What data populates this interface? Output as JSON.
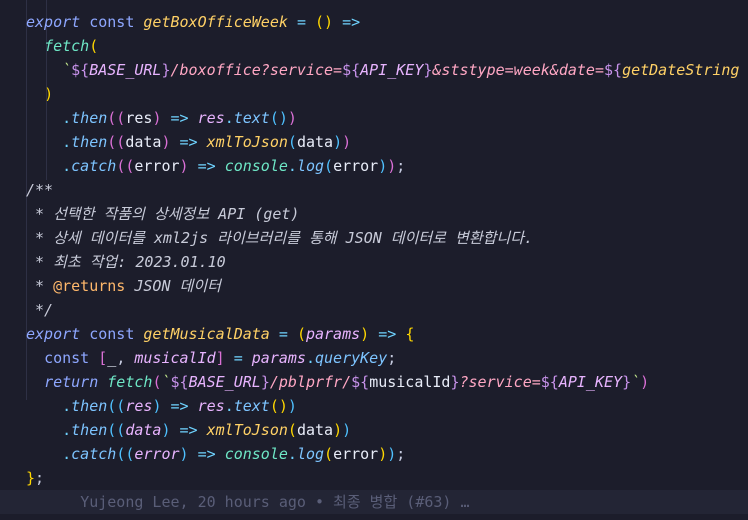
{
  "lines": [
    [
      [
        "kw",
        "export"
      ],
      [
        "var",
        " "
      ],
      [
        "kwn",
        "const"
      ],
      [
        "var",
        " "
      ],
      [
        "fn",
        "getBoxOfficeWeek"
      ],
      [
        "var",
        " "
      ],
      [
        "op",
        "="
      ],
      [
        "var",
        " "
      ],
      [
        "br1",
        "()"
      ],
      [
        "var",
        " "
      ],
      [
        "op",
        "=>"
      ]
    ],
    [
      [
        "var",
        "  "
      ],
      [
        "fnc",
        "fetch"
      ],
      [
        "br1",
        "("
      ]
    ],
    [
      [
        "var",
        "    "
      ],
      [
        "str",
        "`"
      ],
      [
        "tpl",
        "${"
      ],
      [
        "vari",
        "BASE_URL"
      ],
      [
        "tpl",
        "}"
      ],
      [
        "strp",
        "/boxoffice?service="
      ],
      [
        "tpl",
        "${"
      ],
      [
        "vari",
        "API_KEY"
      ],
      [
        "tpl",
        "}"
      ],
      [
        "strp",
        "&ststype=week&date="
      ],
      [
        "tpl",
        "${"
      ],
      [
        "fn",
        "getDateString"
      ]
    ],
    [
      [
        "var",
        "  "
      ],
      [
        "br1",
        ")"
      ]
    ],
    [
      [
        "var",
        "    "
      ],
      [
        "op",
        "."
      ],
      [
        "fnit",
        "then"
      ],
      [
        "br2",
        "(("
      ],
      [
        "var",
        "res"
      ],
      [
        "br2",
        ")"
      ],
      [
        "var",
        " "
      ],
      [
        "op",
        "=>"
      ],
      [
        "var",
        " "
      ],
      [
        "vari",
        "res"
      ],
      [
        "op",
        "."
      ],
      [
        "fnit",
        "text"
      ],
      [
        "br3",
        "()"
      ],
      [
        "br2",
        ")"
      ]
    ],
    [
      [
        "var",
        "    "
      ],
      [
        "op",
        "."
      ],
      [
        "fnit",
        "then"
      ],
      [
        "br2",
        "(("
      ],
      [
        "var",
        "data"
      ],
      [
        "br2",
        ")"
      ],
      [
        "var",
        " "
      ],
      [
        "op",
        "=>"
      ],
      [
        "var",
        " "
      ],
      [
        "fn",
        "xmlToJson"
      ],
      [
        "br3",
        "("
      ],
      [
        "var",
        "data"
      ],
      [
        "br3",
        ")"
      ],
      [
        "br2",
        ")"
      ]
    ],
    [
      [
        "var",
        "    "
      ],
      [
        "op",
        "."
      ],
      [
        "fnit",
        "catch"
      ],
      [
        "br2",
        "(("
      ],
      [
        "var",
        "error"
      ],
      [
        "br2",
        ")"
      ],
      [
        "var",
        " "
      ],
      [
        "op",
        "=>"
      ],
      [
        "var",
        " "
      ],
      [
        "fnc",
        "console"
      ],
      [
        "op",
        "."
      ],
      [
        "fnit",
        "log"
      ],
      [
        "br3",
        "("
      ],
      [
        "var",
        "error"
      ],
      [
        "br3",
        ")"
      ],
      [
        "br2",
        ")"
      ],
      [
        "pun",
        ";"
      ]
    ],
    [
      [
        "cmt",
        "/**"
      ]
    ],
    [
      [
        "cmt",
        " * 선택한 작품의 상세정보 API (get)"
      ]
    ],
    [
      [
        "cmt",
        " * 상세 데이터를 xml2js 라이브러리를 통해 JSON 데이터로 변환합니다."
      ]
    ],
    [
      [
        "cmt",
        " * 최초 작업: 2023.01.10"
      ]
    ],
    [
      [
        "cmt",
        " * "
      ],
      [
        "tag",
        "@returns"
      ],
      [
        "cmt",
        " JSON 데이터"
      ]
    ],
    [
      [
        "cmt",
        " */"
      ]
    ],
    [
      [
        "kw",
        "export"
      ],
      [
        "var",
        " "
      ],
      [
        "kwn",
        "const"
      ],
      [
        "var",
        " "
      ],
      [
        "fn",
        "getMusicalData"
      ],
      [
        "var",
        " "
      ],
      [
        "op",
        "="
      ],
      [
        "var",
        " "
      ],
      [
        "br1",
        "("
      ],
      [
        "vari",
        "params"
      ],
      [
        "br1",
        ")"
      ],
      [
        "var",
        " "
      ],
      [
        "op",
        "=>"
      ],
      [
        "var",
        " "
      ],
      [
        "br1",
        "{"
      ]
    ],
    [
      [
        "var",
        "  "
      ],
      [
        "kwn",
        "const"
      ],
      [
        "var",
        " "
      ],
      [
        "br2",
        "["
      ],
      [
        "var",
        "_"
      ],
      [
        "pun",
        ","
      ],
      [
        "var",
        " "
      ],
      [
        "vari",
        "musicalId"
      ],
      [
        "br2",
        "]"
      ],
      [
        "var",
        " "
      ],
      [
        "op",
        "="
      ],
      [
        "var",
        " "
      ],
      [
        "vari",
        "params"
      ],
      [
        "op",
        "."
      ],
      [
        "fnit",
        "queryKey"
      ],
      [
        "pun",
        ";"
      ]
    ],
    [
      [
        "var",
        "  "
      ],
      [
        "kw",
        "return"
      ],
      [
        "var",
        " "
      ],
      [
        "fnc",
        "fetch"
      ],
      [
        "br2",
        "("
      ],
      [
        "str",
        "`"
      ],
      [
        "tpl",
        "${"
      ],
      [
        "vari",
        "BASE_URL"
      ],
      [
        "tpl",
        "}"
      ],
      [
        "strp",
        "/pblprfr/"
      ],
      [
        "tpl",
        "${"
      ],
      [
        "var",
        "musicalId"
      ],
      [
        "tpl",
        "}"
      ],
      [
        "strp",
        "?service="
      ],
      [
        "tpl",
        "${"
      ],
      [
        "vari",
        "API_KEY"
      ],
      [
        "tpl",
        "}"
      ],
      [
        "str",
        "`"
      ],
      [
        "br2",
        ")"
      ]
    ],
    [
      [
        "var",
        "    "
      ],
      [
        "op",
        "."
      ],
      [
        "fnit",
        "then"
      ],
      [
        "br3",
        "(("
      ],
      [
        "vari",
        "res"
      ],
      [
        "br3",
        ")"
      ],
      [
        "var",
        " "
      ],
      [
        "op",
        "=>"
      ],
      [
        "var",
        " "
      ],
      [
        "vari",
        "res"
      ],
      [
        "op",
        "."
      ],
      [
        "fnit",
        "text"
      ],
      [
        "br1",
        "()"
      ],
      [
        "br3",
        ")"
      ]
    ],
    [
      [
        "var",
        "    "
      ],
      [
        "op",
        "."
      ],
      [
        "fnit",
        "then"
      ],
      [
        "br3",
        "(("
      ],
      [
        "vari",
        "data"
      ],
      [
        "br3",
        ")"
      ],
      [
        "var",
        " "
      ],
      [
        "op",
        "=>"
      ],
      [
        "var",
        " "
      ],
      [
        "fn",
        "xmlToJson"
      ],
      [
        "br1",
        "("
      ],
      [
        "var",
        "data"
      ],
      [
        "br1",
        ")"
      ],
      [
        "br3",
        ")"
      ]
    ],
    [
      [
        "var",
        "    "
      ],
      [
        "op",
        "."
      ],
      [
        "fnit",
        "catch"
      ],
      [
        "br3",
        "(("
      ],
      [
        "vari",
        "error"
      ],
      [
        "br3",
        ")"
      ],
      [
        "var",
        " "
      ],
      [
        "op",
        "=>"
      ],
      [
        "var",
        " "
      ],
      [
        "fnc",
        "console"
      ],
      [
        "op",
        "."
      ],
      [
        "fnit",
        "log"
      ],
      [
        "br1",
        "("
      ],
      [
        "var",
        "error"
      ],
      [
        "br1",
        ")"
      ],
      [
        "br3",
        ")"
      ],
      [
        "pun",
        ";"
      ]
    ],
    [
      [
        "br1",
        "}"
      ],
      [
        "pun",
        ";"
      ]
    ],
    [
      [
        "var",
        "      "
      ],
      [
        "blame",
        "Yujeong Lee, 20 hours ago • 최종 병합 (#63) …"
      ]
    ]
  ],
  "theme": {
    "background": "#1c1d2b",
    "current_line": "#232535"
  }
}
